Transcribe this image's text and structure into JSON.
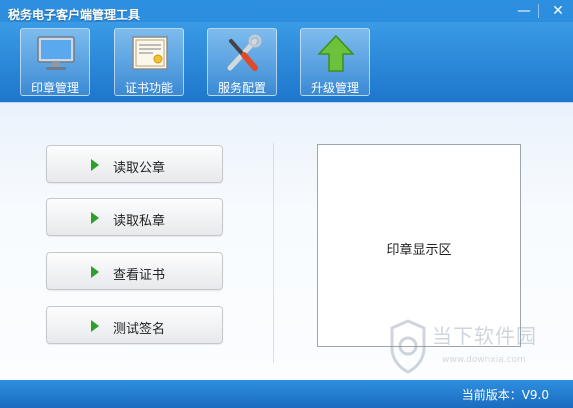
{
  "window": {
    "title": "税务电子客户端管理工具",
    "minimize_glyph": "—",
    "close_glyph": "✕"
  },
  "toolbar": {
    "items": [
      {
        "label": "印章管理",
        "icon": "monitor-icon"
      },
      {
        "label": "证书功能",
        "icon": "certificate-icon"
      },
      {
        "label": "服务配置",
        "icon": "tools-icon"
      },
      {
        "label": "升级管理",
        "icon": "upgrade-arrow-icon"
      }
    ]
  },
  "actions": [
    {
      "label": "读取公章"
    },
    {
      "label": "读取私章"
    },
    {
      "label": "查看证书"
    },
    {
      "label": "测试签名"
    }
  ],
  "seal_display": {
    "label": "印章显示区"
  },
  "watermark": {
    "name": "当下软件园",
    "url": "www.downxia.com"
  },
  "status": {
    "version_label": "当前版本：",
    "version": "V9.0"
  },
  "colors": {
    "accent": "#1f74c9",
    "arrow_green": "#2e9e2e"
  }
}
